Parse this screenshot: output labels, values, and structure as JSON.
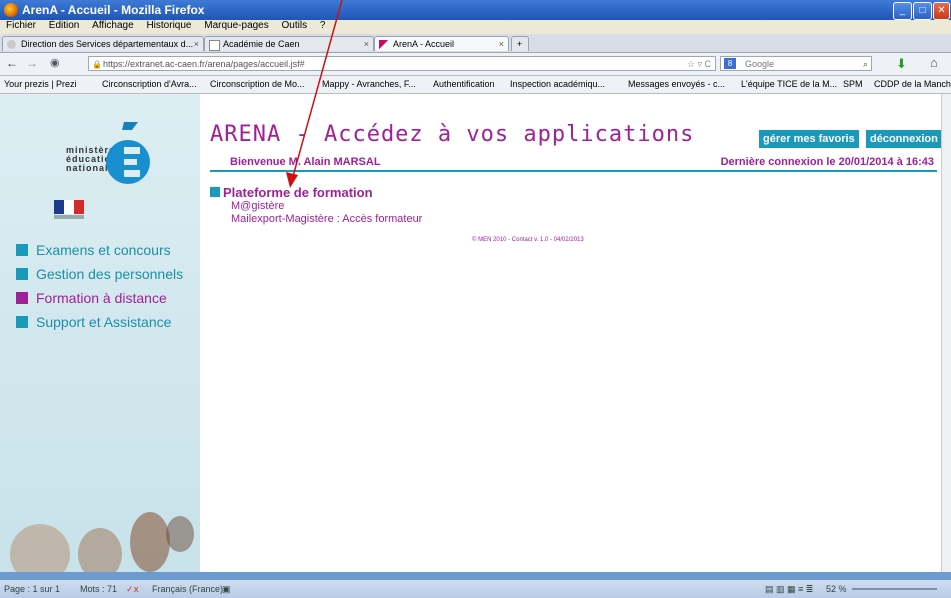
{
  "window": {
    "title": "ArenA - Accueil - Mozilla Firefox"
  },
  "menu": [
    "Fichier",
    "Édition",
    "Affichage",
    "Historique",
    "Marque-pages",
    "Outils",
    "?"
  ],
  "tabs": [
    {
      "label": "Direction des Services départementaux d...",
      "active": false
    },
    {
      "label": "Académie de Caen",
      "active": false
    },
    {
      "label": "ArenA - Accueil",
      "active": true
    }
  ],
  "address": {
    "url": "https://extranet.ac-caen.fr/arena/pages/accueil.jsf#",
    "search_placeholder": "Google"
  },
  "bookmarks": [
    "Your prezis | Prezi",
    "Circonscription d'Avra...",
    "Circonscription de Mo...",
    "Mappy - Avranches, F...",
    "Authentification",
    "Inspection académiqu...",
    "Messages envoyés - c...",
    "L'équipe TICE de la M...",
    "SPM",
    "CDDP de la Manche"
  ],
  "logo": {
    "line1": "ministère",
    "line2": "éducation",
    "line3": "nationale"
  },
  "sidebar": {
    "items": [
      {
        "label": "Examens et concours"
      },
      {
        "label": "Gestion des personnels"
      },
      {
        "label": "Formation à distance"
      },
      {
        "label": "Support et Assistance"
      }
    ]
  },
  "header": {
    "title": "ARENA - Accédez à vos applications",
    "favorites_btn": "gérer mes favoris",
    "logout_btn": "déconnexion",
    "welcome": "Bienvenue M. Alain MARSAL",
    "last_login": "Dernière connexion le 20/01/2014 à  16:43"
  },
  "content": {
    "section_title": "Plateforme de formation",
    "links": [
      "M@gistère",
      "Mailexport-Magistère : Accès formateur"
    ],
    "footer": "© MEN 2010 - Contact v. 1.0 - 04/02/2013"
  },
  "statusbar": {
    "page": "Page : 1 sur 1",
    "words": "Mots : 71",
    "language": "Français (France)",
    "zoom": "52 %"
  },
  "colors": {
    "accent_purple": "#a0209a",
    "accent_teal": "#1a9abb",
    "sidebar_bg": "#d0e7ee"
  }
}
